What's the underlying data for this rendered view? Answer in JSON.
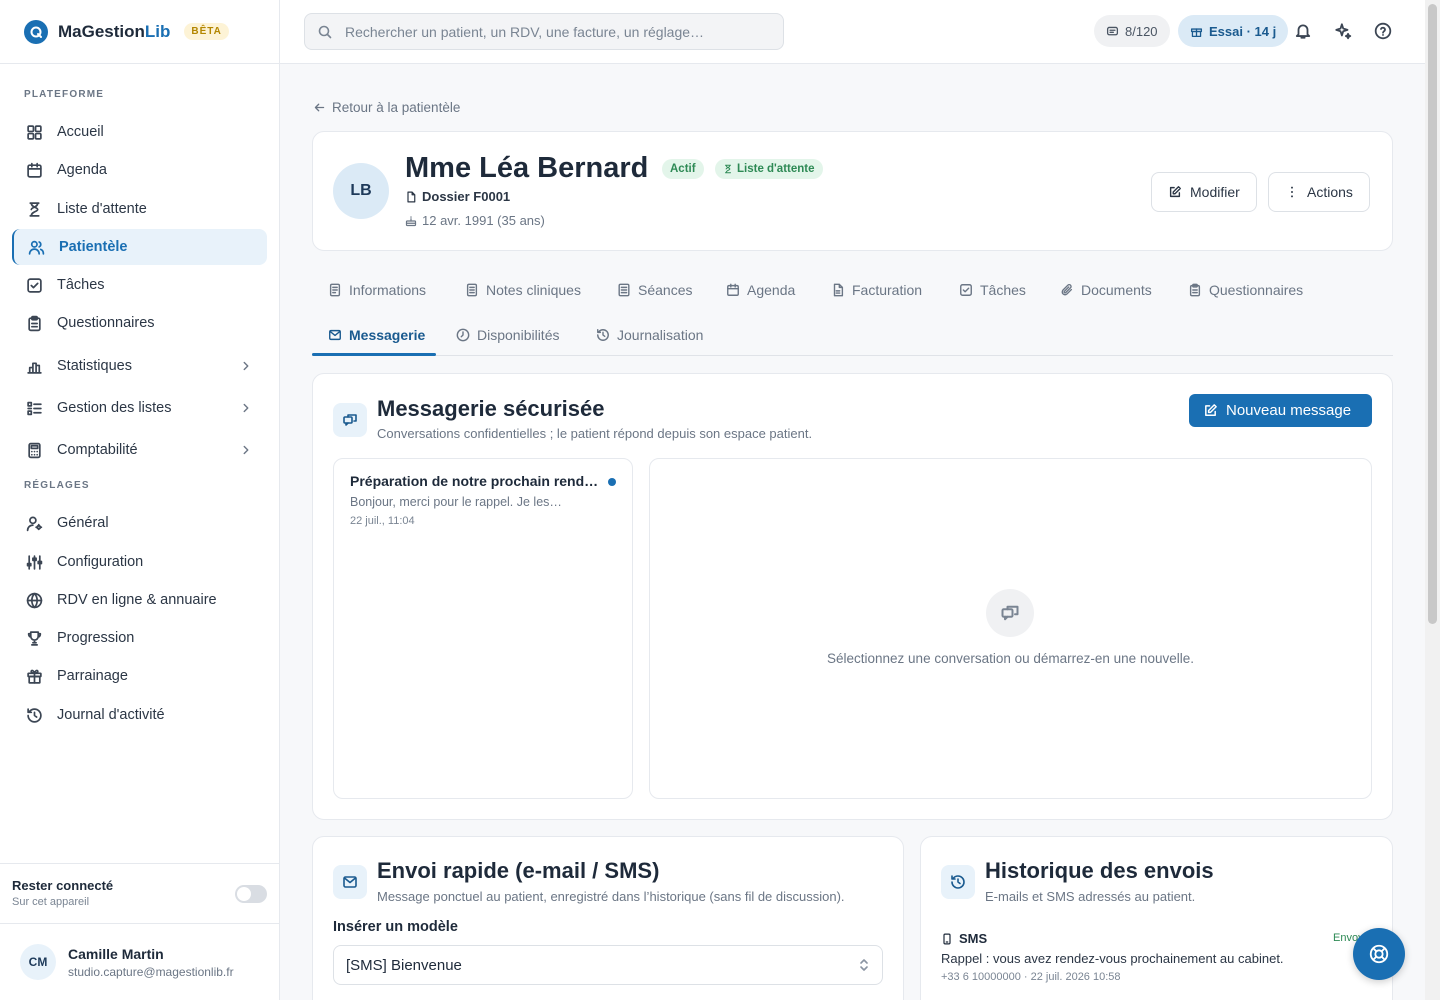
{
  "brand": {
    "name_part1": "MaGestion",
    "name_part2": "Lib",
    "badge": "BÊTA"
  },
  "sidebar": {
    "section_platform": "PLATEFORME",
    "section_settings": "RÉGLAGES",
    "items": [
      {
        "label": "Accueil",
        "icon": "grid-icon"
      },
      {
        "label": "Agenda",
        "icon": "calendar-icon"
      },
      {
        "label": "Liste d'attente",
        "icon": "hourglass-icon"
      },
      {
        "label": "Patientèle",
        "icon": "users-icon",
        "active": true
      },
      {
        "label": "Tâches",
        "icon": "checkbox-icon"
      },
      {
        "label": "Questionnaires",
        "icon": "clipboard-icon"
      },
      {
        "label": "Statistiques",
        "icon": "bar-chart-icon"
      },
      {
        "label": "Gestion des listes",
        "icon": "list-icon"
      },
      {
        "label": "Comptabilité",
        "icon": "calculator-icon"
      },
      {
        "label": "Général",
        "icon": "user-cog-icon"
      },
      {
        "label": "Configuration",
        "icon": "sliders-icon"
      },
      {
        "label": "RDV en ligne & annuaire",
        "icon": "globe-icon"
      },
      {
        "label": "Progression",
        "icon": "trophy-icon"
      },
      {
        "label": "Parrainage",
        "icon": "gift-icon"
      },
      {
        "label": "Journal d'activité",
        "icon": "history-icon"
      }
    ],
    "stay_connected": {
      "title": "Rester connecté",
      "subtitle": "Sur cet appareil",
      "on": false
    },
    "user": {
      "initials": "CM",
      "name": "Camille Martin",
      "email": "studio.capture@magestionlib.fr"
    }
  },
  "topbar": {
    "search_placeholder": "Rechercher un patient, un RDV, une facture, un réglage…",
    "quota": "8/120",
    "trial": "Essai · 14 j"
  },
  "patient": {
    "back_link": "Retour à la patientèle",
    "initials": "LB",
    "name": "Mme Léa Bernard",
    "status_badge": "Actif",
    "waitlist_badge": "Liste d'attente",
    "file": "Dossier F0001",
    "birth": "12 avr. 1991 (35 ans)",
    "edit_button": "Modifier",
    "actions_button": "Actions"
  },
  "tabs": [
    {
      "label": "Informations",
      "icon": "doc-icon"
    },
    {
      "label": "Notes cliniques",
      "icon": "notes-icon"
    },
    {
      "label": "Séances",
      "icon": "sessions-icon"
    },
    {
      "label": "Agenda",
      "icon": "calendar-icon"
    },
    {
      "label": "Facturation",
      "icon": "invoice-icon"
    },
    {
      "label": "Tâches",
      "icon": "checkbox-icon"
    },
    {
      "label": "Documents",
      "icon": "paperclip-icon"
    },
    {
      "label": "Questionnaires",
      "icon": "clipboard-icon"
    },
    {
      "label": "Messagerie",
      "icon": "mail-icon",
      "active": true
    },
    {
      "label": "Disponibilités",
      "icon": "clock-icon"
    },
    {
      "label": "Journalisation",
      "icon": "history-icon"
    }
  ],
  "messaging": {
    "title": "Messagerie sécurisée",
    "subtitle": "Conversations confidentielles ; le patient répond depuis son espace patient.",
    "new_button": "Nouveau message",
    "conversations": [
      {
        "title": "Préparation de notre prochain rendez-vous",
        "preview": "Bonjour, merci pour le rappel. Je les…",
        "date": "22 juil., 11:04",
        "unread": true
      }
    ],
    "empty_text": "Sélectionnez une conversation ou démarrez-en une nouvelle."
  },
  "quick_send": {
    "title": "Envoi rapide (e-mail / SMS)",
    "subtitle": "Message ponctuel au patient, enregistré dans l’historique (sans fil de discussion).",
    "template_label": "Insérer un modèle",
    "template_value": "[SMS] Bienvenue"
  },
  "history": {
    "title": "Historique des envois",
    "subtitle": "E-mails et SMS adressés au patient.",
    "entry": {
      "type": "SMS",
      "text": "Rappel : vous avez rendez-vous prochainement au cabinet.",
      "meta": "+33 6 10000000 · 22 juil. 2026 10:58",
      "status": "Envoyé"
    }
  },
  "colors": {
    "accent": "#1a6fb3",
    "success": "#2e8a55",
    "beta": "#b38600"
  }
}
